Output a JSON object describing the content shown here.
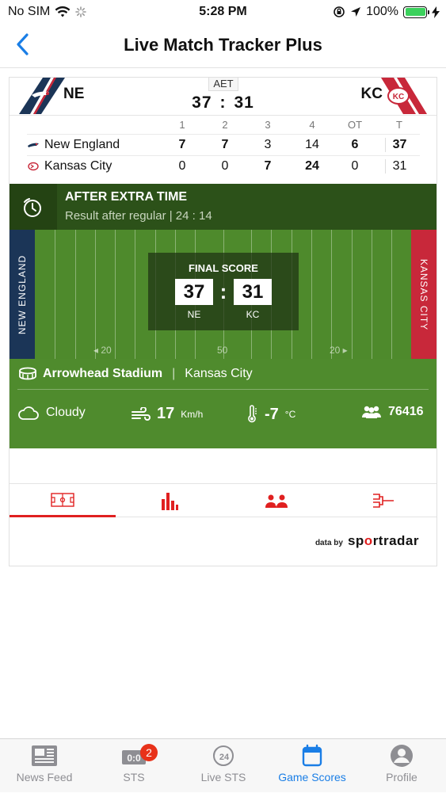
{
  "status": {
    "carrier": "No SIM",
    "time": "5:28 PM",
    "battery": "100%"
  },
  "nav": {
    "title": "Live Match Tracker Plus",
    "back_icon": "chevron-left-icon"
  },
  "match": {
    "status_label": "AET",
    "home": {
      "abbr": "NE",
      "name": "New England",
      "score": "37"
    },
    "away": {
      "abbr": "KC",
      "name": "Kansas City",
      "score": "31"
    },
    "score_separator": ":",
    "periods": [
      "1",
      "2",
      "3",
      "4",
      "OT",
      "T"
    ],
    "home_periods": [
      "7",
      "7",
      "3",
      "14",
      "6",
      "37"
    ],
    "away_periods": [
      "0",
      "0",
      "7",
      "24",
      "0",
      "31"
    ]
  },
  "banner": {
    "title": "AFTER EXTRA TIME",
    "subtitle": "Result after regular  |  24 : 14"
  },
  "field": {
    "left_endzone": "NEW ENGLAND",
    "right_endzone": "KANSAS CITY",
    "final_label": "FINAL SCORE",
    "home_score": "37",
    "away_score": "31",
    "home_abbr": "NE",
    "away_abbr": "KC",
    "yard_left": "◂ 20",
    "yard_mid": "50",
    "yard_right": "20 ▸"
  },
  "venue": {
    "stadium": "Arrowhead Stadium",
    "city": "Kansas City",
    "weather": "Cloudy",
    "wind": "17",
    "wind_unit": "Km/h",
    "temp": "-7",
    "temp_unit": "°C",
    "attendance": "76416"
  },
  "tabs": [
    {
      "name": "field-tab",
      "icon": "field-icon"
    },
    {
      "name": "stats-tab",
      "icon": "bar-chart-icon"
    },
    {
      "name": "lineups-tab",
      "icon": "players-icon"
    },
    {
      "name": "bracket-tab",
      "icon": "bracket-icon"
    }
  ],
  "powered": {
    "prefix": "data by",
    "brand_a": "sp",
    "brand_b": "o",
    "brand_c": "rtradar"
  },
  "tabbar": {
    "items": [
      {
        "label": "News Feed"
      },
      {
        "label": "STS",
        "badge": "2"
      },
      {
        "label": "Live STS"
      },
      {
        "label": "Game Scores"
      },
      {
        "label": "Profile"
      }
    ]
  },
  "colors": {
    "accent_red": "#e02020",
    "active_blue": "#1a7ee6",
    "field_green": "#4e8a2c",
    "ne_navy": "#1b3557",
    "kc_red": "#c8283a"
  }
}
